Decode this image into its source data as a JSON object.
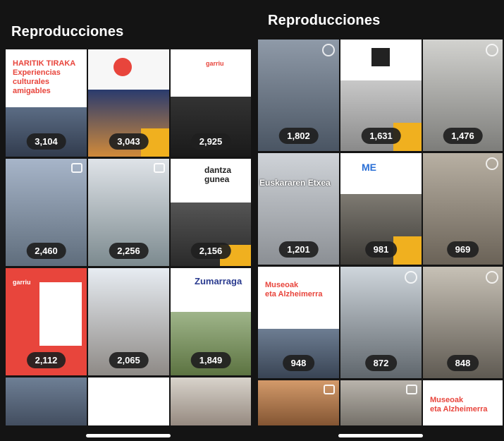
{
  "left": {
    "title": "Reproducciones",
    "tiles": [
      {
        "count": "3,104",
        "text": "HARITIK TIRAKA\nExperiencias\nculturales amigables"
      },
      {
        "count": "3,043",
        "text": ""
      },
      {
        "count": "2,925",
        "text": "garriu"
      },
      {
        "count": "2,460",
        "text": ""
      },
      {
        "count": "2,256",
        "text": ""
      },
      {
        "count": "2,156",
        "text": "dantza\ngunea"
      },
      {
        "count": "2,112",
        "text": "garriu"
      },
      {
        "count": "2,065",
        "text": ""
      },
      {
        "count": "1,849",
        "text": "Zumarraga"
      }
    ]
  },
  "right": {
    "title": "Reproducciones",
    "tiles": [
      {
        "count": "1,802",
        "text": ""
      },
      {
        "count": "1,631",
        "text": ""
      },
      {
        "count": "1,476",
        "text": ""
      },
      {
        "count": "1,201",
        "text": "Euskararen Etxea"
      },
      {
        "count": "981",
        "text": "ME"
      },
      {
        "count": "969",
        "text": ""
      },
      {
        "count": "948",
        "text": "Museoak\neta Alzheimerra"
      },
      {
        "count": "872",
        "text": ""
      },
      {
        "count": "848",
        "text": ""
      }
    ],
    "bottom_text": "Museoak\neta Alzheimerra"
  },
  "colors": {
    "bg": "#141414",
    "accent_red": "#e8453c",
    "accent_yellow": "#f0b01f"
  }
}
